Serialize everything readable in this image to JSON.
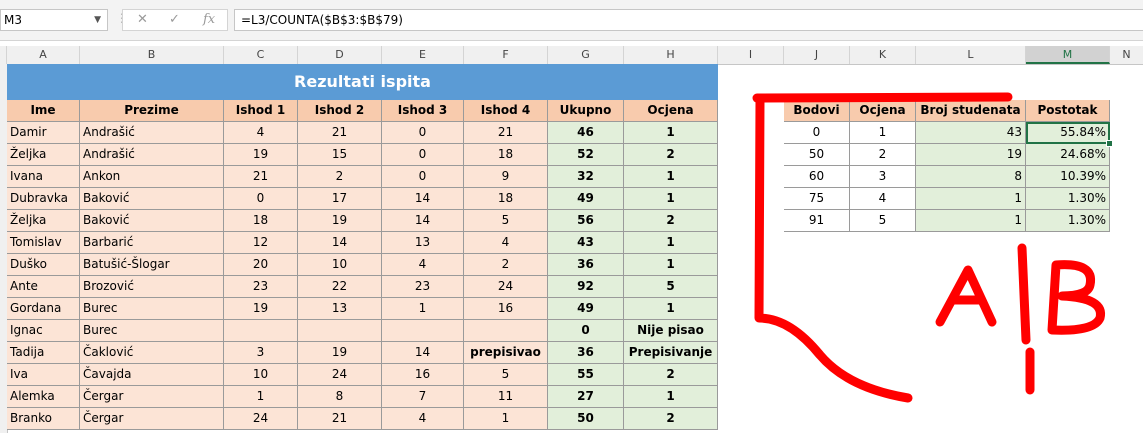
{
  "formula_bar": {
    "name_box": "M3",
    "cancel_glyph": "✕",
    "enter_glyph": "✓",
    "fx_glyph": "fx",
    "formula": "=L3/COUNTA($B$3:$B$79)"
  },
  "columns": [
    "A",
    "B",
    "C",
    "D",
    "E",
    "F",
    "G",
    "H",
    "I",
    "J",
    "K",
    "L",
    "M",
    "N"
  ],
  "main_table": {
    "title": "Rezultati ispita",
    "headers": [
      "Ime",
      "Prezime",
      "Ishod 1",
      "Ishod 2",
      "Ishod 3",
      "Ishod 4",
      "Ukupno",
      "Ocjena"
    ],
    "rows": [
      [
        "Damir",
        "Andrašić",
        "4",
        "21",
        "0",
        "21",
        "46",
        "1"
      ],
      [
        "Željka",
        "Andrašić",
        "19",
        "15",
        "0",
        "18",
        "52",
        "2"
      ],
      [
        "Ivana",
        "Ankon",
        "21",
        "2",
        "0",
        "9",
        "32",
        "1"
      ],
      [
        "Dubravka",
        "Baković",
        "0",
        "17",
        "14",
        "18",
        "49",
        "1"
      ],
      [
        "Željka",
        "Baković",
        "18",
        "19",
        "14",
        "5",
        "56",
        "2"
      ],
      [
        "Tomislav",
        "Barbarić",
        "12",
        "14",
        "13",
        "4",
        "43",
        "1"
      ],
      [
        "Duško",
        "Batušić-Šlogar",
        "20",
        "10",
        "4",
        "2",
        "36",
        "1"
      ],
      [
        "Ante",
        "Brozović",
        "23",
        "22",
        "23",
        "24",
        "92",
        "5"
      ],
      [
        "Gordana",
        "Burec",
        "19",
        "13",
        "1",
        "16",
        "49",
        "1"
      ],
      [
        "Ignac",
        "Burec",
        "",
        "",
        "",
        "",
        "0",
        "Nije pisao"
      ],
      [
        "Tadija",
        "Čaklović",
        "3",
        "19",
        "14",
        "prepisivao",
        "36",
        "Prepisivanje"
      ],
      [
        "Iva",
        "Čavajda",
        "10",
        "24",
        "16",
        "5",
        "55",
        "2"
      ],
      [
        "Alemka",
        "Čergar",
        "1",
        "8",
        "7",
        "11",
        "27",
        "1"
      ],
      [
        "Branko",
        "Čergar",
        "24",
        "21",
        "4",
        "1",
        "50",
        "2"
      ]
    ]
  },
  "grade_table": {
    "headers": [
      "Bodovi",
      "Ocjena",
      "Broj studenata",
      "Postotak"
    ],
    "rows": [
      [
        "0",
        "1",
        "43",
        "55.84%"
      ],
      [
        "50",
        "2",
        "19",
        "24.68%"
      ],
      [
        "60",
        "3",
        "8",
        "10.39%"
      ],
      [
        "75",
        "4",
        "1",
        "1.30%"
      ],
      [
        "91",
        "5",
        "1",
        "1.30%"
      ]
    ]
  },
  "annotation": {
    "left_letter": "A",
    "right_letter": "B",
    "color": "#ff0000"
  }
}
